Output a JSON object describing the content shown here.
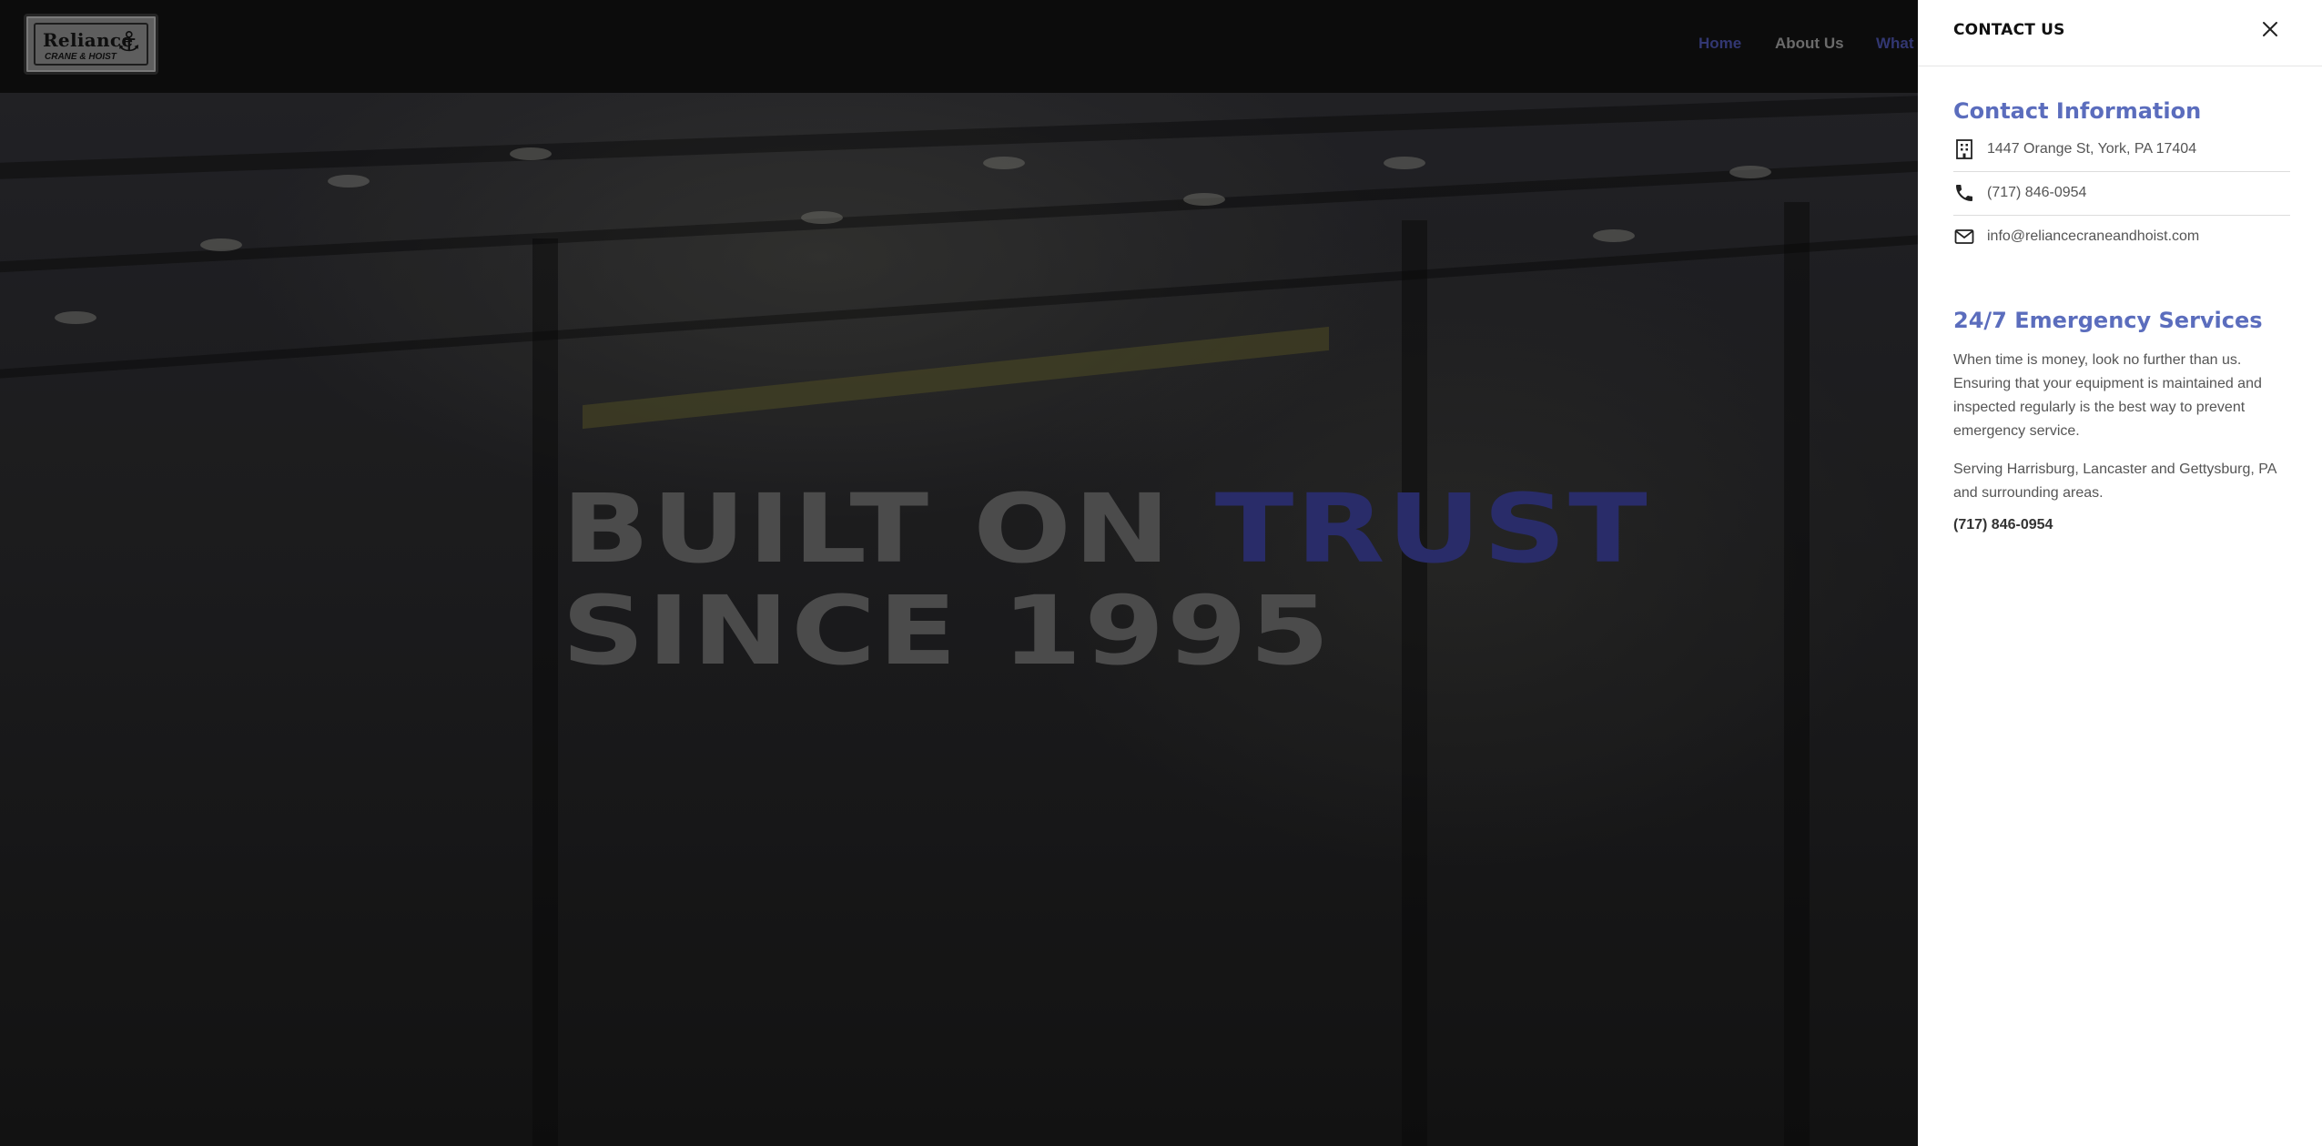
{
  "header": {
    "logo": {
      "name": "Reliance",
      "tagline": "CRANE & HOIST"
    },
    "nav": [
      {
        "label": "Home",
        "state": "active"
      },
      {
        "label": "About Us"
      },
      {
        "label": "What"
      }
    ]
  },
  "hero": {
    "line1_plain": "BUILT ON ",
    "line1_accent": "TRUST",
    "line2": "SINCE 1995"
  },
  "drawer": {
    "title": "CONTACT US",
    "close_icon": "close-icon",
    "contact_heading": "Contact Information",
    "address": {
      "icon": "building-icon",
      "text": "1447 Orange St, York, PA 17404"
    },
    "phone": {
      "icon": "phone-icon",
      "text": "(717) 846-0954"
    },
    "email": {
      "icon": "envelope-icon",
      "text": "info@reliancecraneandhoist.com"
    },
    "emergency_heading": "24/7 Emergency Services",
    "emergency_text": "When time is money, look no further than us. Ensuring that your equipment is maintained and inspected regularly is the best way to prevent emergency service.",
    "service_area": "Serving Harrisburg, Lancaster and Gettysburg, PA and surrounding areas.",
    "emergency_phone": "(717) 846-0954"
  },
  "colors": {
    "accent": "#5b6dbd",
    "accent_dimmed": "#2f3378",
    "drawer_bg": "#ffffff",
    "page_bg": "#0e0e0e"
  }
}
